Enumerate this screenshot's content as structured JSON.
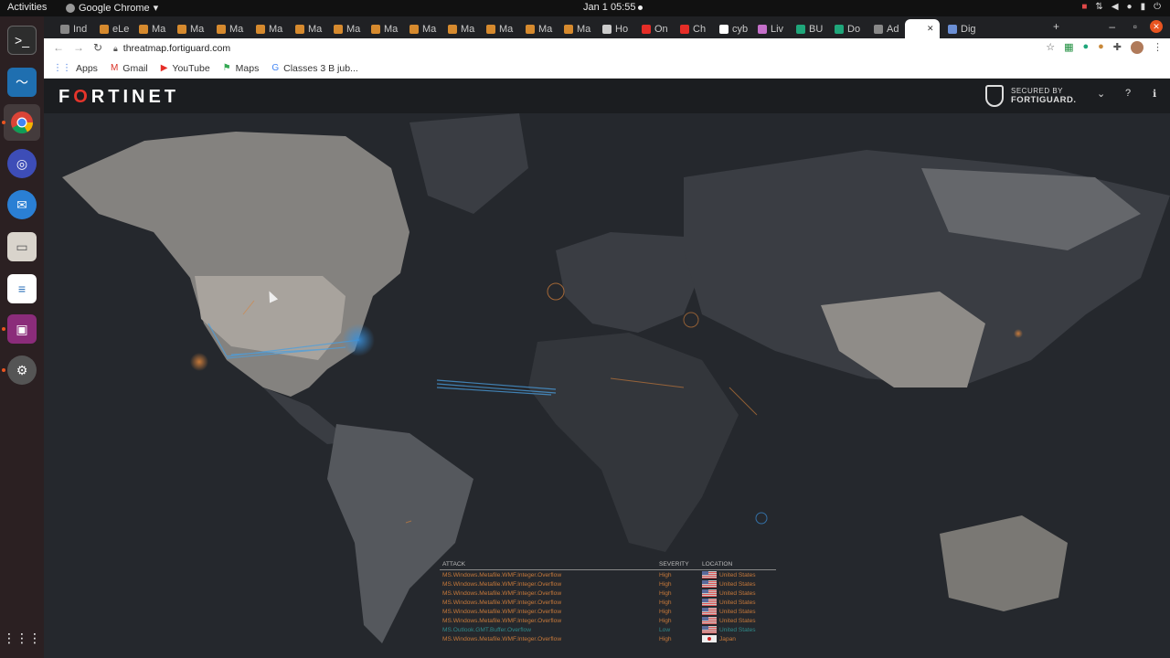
{
  "os": {
    "activities": "Activities",
    "app_name": "Google Chrome",
    "clock": "Jan 1  05:55"
  },
  "dock": {
    "items": [
      "terminal",
      "system-monitor",
      "chrome",
      "pidgin",
      "thunderbird",
      "files",
      "writer",
      "screen-recorder",
      "settings"
    ],
    "show_apps": "show-apps"
  },
  "tabs": [
    {
      "label": "Ind",
      "icon": "page",
      "color": "#888888"
    },
    {
      "label": "eLe",
      "icon": "m-icon",
      "color": "#d68a2e"
    },
    {
      "label": "Ma",
      "icon": "m-icon",
      "color": "#d68a2e"
    },
    {
      "label": "Ma",
      "icon": "m-icon",
      "color": "#d68a2e"
    },
    {
      "label": "Ma",
      "icon": "m-icon",
      "color": "#d68a2e"
    },
    {
      "label": "Ma",
      "icon": "m-icon",
      "color": "#d68a2e"
    },
    {
      "label": "Ma",
      "icon": "m-icon",
      "color": "#d68a2e"
    },
    {
      "label": "Ma",
      "icon": "m-icon",
      "color": "#d68a2e"
    },
    {
      "label": "Ma",
      "icon": "m-icon",
      "color": "#d68a2e"
    },
    {
      "label": "Ma",
      "icon": "m-icon",
      "color": "#d68a2e"
    },
    {
      "label": "Ma",
      "icon": "m-icon",
      "color": "#d68a2e"
    },
    {
      "label": "Ma",
      "icon": "m-icon",
      "color": "#d68a2e"
    },
    {
      "label": "Ma",
      "icon": "m-icon",
      "color": "#d68a2e"
    },
    {
      "label": "Ma",
      "icon": "m-icon",
      "color": "#d68a2e"
    },
    {
      "label": "Ho",
      "icon": "page",
      "color": "#cccccc"
    },
    {
      "label": "On",
      "icon": "youtube-icon",
      "color": "#e52d27"
    },
    {
      "label": "Ch",
      "icon": "youtube-icon",
      "color": "#e52d27"
    },
    {
      "label": "cyb",
      "icon": "google-icon",
      "color": "#ffffff"
    },
    {
      "label": "Liv",
      "icon": "page",
      "color": "#c46fc9"
    },
    {
      "label": "BU",
      "icon": "k-icon",
      "color": "#1fa67a"
    },
    {
      "label": "Do",
      "icon": "k-icon",
      "color": "#1fa67a"
    },
    {
      "label": "Ad",
      "icon": "page",
      "color": "#888888"
    },
    {
      "label": "",
      "icon": "fortinet-icon",
      "color": "#ffffff"
    },
    {
      "label": "Dig",
      "icon": "grid-icon",
      "color": "#6b8fd4"
    }
  ],
  "address_bar": {
    "url": "threatmap.fortiguard.com"
  },
  "bookmarks": [
    {
      "label": "Apps",
      "icon": "apps-grid-icon",
      "color": "#4a7de0"
    },
    {
      "label": "Gmail",
      "icon": "gmail-icon",
      "color": "#d93025"
    },
    {
      "label": "YouTube",
      "icon": "youtube-icon",
      "color": "#e52d27"
    },
    {
      "label": "Maps",
      "icon": "maps-icon",
      "color": "#34a853"
    },
    {
      "label": "Classes 3 B jub...",
      "icon": "google-icon",
      "color": "#4285f4"
    }
  ],
  "page": {
    "logo_letters": [
      "F",
      "RTINET"
    ],
    "logo_o": "O",
    "secured_line1": "SECURED BY",
    "secured_line2": "FORTIGUARD."
  },
  "attack_table": {
    "headers": {
      "attack": "ATTACK",
      "severity": "SEVERITY",
      "location": "LOCATION"
    },
    "rows": [
      {
        "attack": "MS.Windows.Metafile.WMF.Integer.Overflow",
        "severity": "High",
        "location": "United States",
        "flag": "us",
        "color": "#c7793a"
      },
      {
        "attack": "MS.Windows.Metafile.WMF.Integer.Overflow",
        "severity": "High",
        "location": "United States",
        "flag": "us",
        "color": "#c7793a"
      },
      {
        "attack": "MS.Windows.Metafile.WMF.Integer.Overflow",
        "severity": "High",
        "location": "United States",
        "flag": "us",
        "color": "#c7793a"
      },
      {
        "attack": "MS.Windows.Metafile.WMF.Integer.Overflow",
        "severity": "High",
        "location": "United States",
        "flag": "us",
        "color": "#c7793a"
      },
      {
        "attack": "MS.Windows.Metafile.WMF.Integer.Overflow",
        "severity": "High",
        "location": "United States",
        "flag": "us",
        "color": "#c7793a"
      },
      {
        "attack": "MS.Windows.Metafile.WMF.Integer.Overflow",
        "severity": "High",
        "location": "United States",
        "flag": "us",
        "color": "#c7793a"
      },
      {
        "attack": "MS.Outlook.GMT.Buffer.Overflow",
        "severity": "Low",
        "location": "United States",
        "flag": "us",
        "color": "#2f8a8a"
      },
      {
        "attack": "MS.Windows.Metafile.WMF.Integer.Overflow",
        "severity": "High",
        "location": "Japan",
        "flag": "jp",
        "color": "#c7793a"
      }
    ]
  }
}
